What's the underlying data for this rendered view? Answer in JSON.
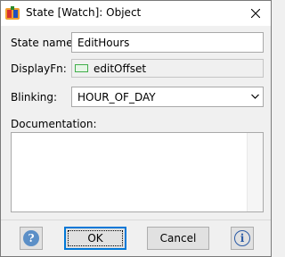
{
  "window": {
    "title": "State [Watch]: Object",
    "icons": {
      "app": "app-icon",
      "close": "close-icon"
    }
  },
  "form": {
    "state_name": {
      "label": "State name:",
      "value": "EditHours"
    },
    "display_fn": {
      "label": "DisplayFn:",
      "value": "editOffset",
      "swatch_color": "#3fae49"
    },
    "blinking": {
      "label": "Blinking:",
      "value": "HOUR_OF_DAY"
    },
    "documentation": {
      "label": "Documentation:",
      "value": ""
    }
  },
  "buttons": {
    "help_icon": "question-mark-icon",
    "ok": "OK",
    "cancel": "Cancel",
    "info_icon": "info-icon"
  },
  "colors": {
    "accent": "#0078d7",
    "help_icon": "#5b8fc7",
    "info_icon": "#2a5aa5"
  }
}
